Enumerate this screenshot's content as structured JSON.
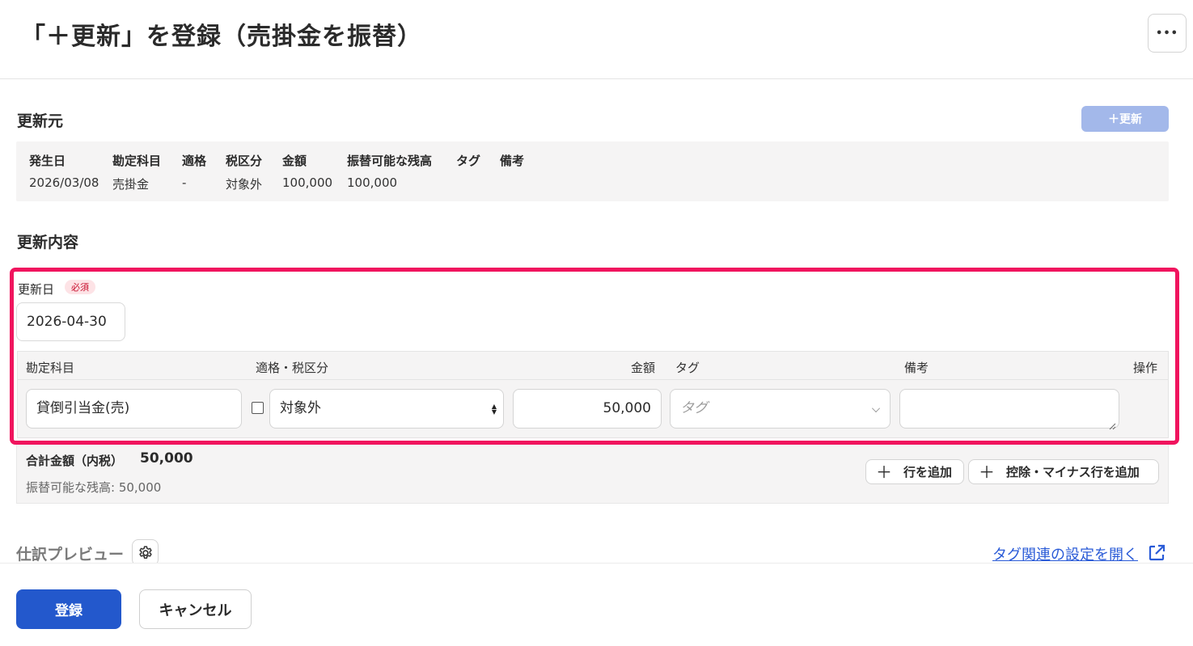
{
  "header": {
    "title": "「＋更新」を登録（売掛金を振替）",
    "more_label": "•••"
  },
  "source": {
    "title": "更新元",
    "renew_button": "＋更新",
    "columns": [
      "発生日",
      "勘定科目",
      "適格",
      "税区分",
      "金額",
      "振替可能な残高",
      "タグ",
      "備考"
    ],
    "row": [
      "2026/03/08",
      "売掛金",
      "-",
      "対象外",
      "100,000",
      "100,000",
      "",
      ""
    ]
  },
  "content": {
    "title": "更新内容",
    "date_label": "更新日",
    "required_badge": "必須",
    "date_value": "2026-04-30",
    "table_headers": {
      "account": "勘定科目",
      "tax": "適格・税区分",
      "amount": "金額",
      "tag": "タグ",
      "note": "備考",
      "action": "操作"
    },
    "line": {
      "account": "貸倒引当金(売)",
      "qualified_checked": false,
      "tax": "対象外",
      "amount": "50,000",
      "tag_placeholder": "タグ",
      "note": ""
    },
    "total_label": "合計金額（内税）",
    "total_value": "50,000",
    "remaining_text": "振替可能な残高: 50,000",
    "add_row_button": "行を追加",
    "add_minus_button": "控除・マイナス行を追加"
  },
  "preview": {
    "title": "仕訳プレビュー",
    "tag_settings_link": "タグ関連の設定を開く"
  },
  "footer": {
    "register_button": "登録",
    "cancel_button": "キャンセル"
  },
  "colors": {
    "primary": "#2358cc",
    "highlight": "#f0145e",
    "link": "#2a5bd7",
    "renew_button": "#a3b8ea"
  }
}
